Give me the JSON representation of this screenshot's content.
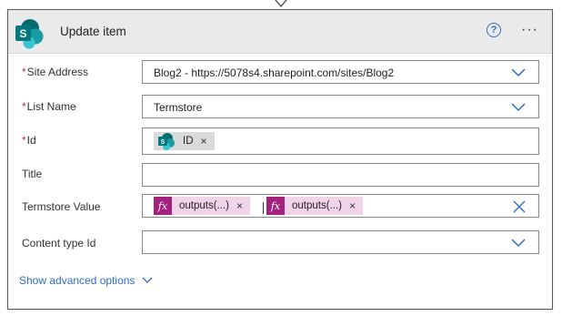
{
  "header": {
    "title": "Update item",
    "help_icon": "help-circle-icon",
    "help_glyph": "?",
    "more_label": "···",
    "logo_letter": "S"
  },
  "fields": {
    "site_address": {
      "label": "Site Address",
      "required": "*",
      "value": "Blog2 - https://5078s4.sharepoint.com/sites/Blog2"
    },
    "list_name": {
      "label": "List Name",
      "required": "*",
      "value": "Termstore"
    },
    "id": {
      "label": "Id",
      "required": "*",
      "token": "ID"
    },
    "title": {
      "label": "Title",
      "value": ""
    },
    "termstore_value": {
      "label": "Termstore Value",
      "tokens": [
        "outputs(...)",
        "outputs(...)"
      ],
      "fx_glyph": "fx"
    },
    "content_type_id": {
      "label": "Content type Id",
      "value": ""
    }
  },
  "token_remove": "×",
  "advanced_options": "Show advanced options",
  "colors": {
    "accent": "#2f6ec7",
    "required": "#c4314b",
    "sharepoint": "#038387",
    "expression": "#a4217f"
  }
}
